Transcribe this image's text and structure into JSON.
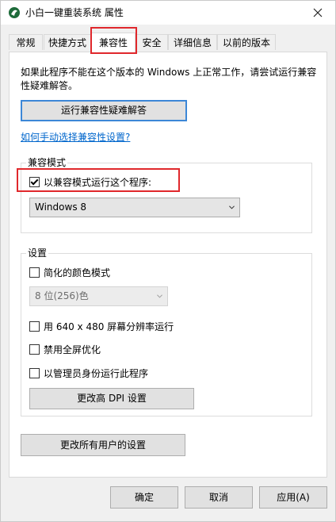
{
  "window": {
    "title": "小白一键重装系统 属性"
  },
  "tabs": [
    {
      "label": "常规",
      "active": false
    },
    {
      "label": "快捷方式",
      "active": false
    },
    {
      "label": "兼容性",
      "active": true
    },
    {
      "label": "安全",
      "active": false
    },
    {
      "label": "详细信息",
      "active": false
    },
    {
      "label": "以前的版本",
      "active": false
    }
  ],
  "compat": {
    "description": "如果此程序不能在这个版本的 Windows 上正常工作，请尝试运行兼容性疑难解答。",
    "troubleshoot_button": "运行兼容性疑难解答",
    "manual_link": "如何手动选择兼容性设置?",
    "mode_group_label": "兼容模式",
    "mode_checkbox_label": "以兼容模式运行这个程序:",
    "mode_checkbox_checked": true,
    "mode_select_value": "Windows 8"
  },
  "settings": {
    "group_label": "设置",
    "reduced_color_label": "简化的颜色模式",
    "reduced_color_checked": false,
    "color_select_value": "8 位(256)色",
    "res_640_label": "用 640 x 480 屏幕分辨率运行",
    "res_640_checked": false,
    "disable_fullscreen_label": "禁用全屏优化",
    "disable_fullscreen_checked": false,
    "run_admin_label": "以管理员身份运行此程序",
    "run_admin_checked": false,
    "dpi_button": "更改高 DPI 设置"
  },
  "all_users_button": "更改所有用户的设置",
  "footer": {
    "ok": "确定",
    "cancel": "取消",
    "apply": "应用(A)"
  },
  "colors": {
    "highlight": "#e0282c",
    "link": "#0066cc",
    "focus_border": "#3c87d7"
  }
}
